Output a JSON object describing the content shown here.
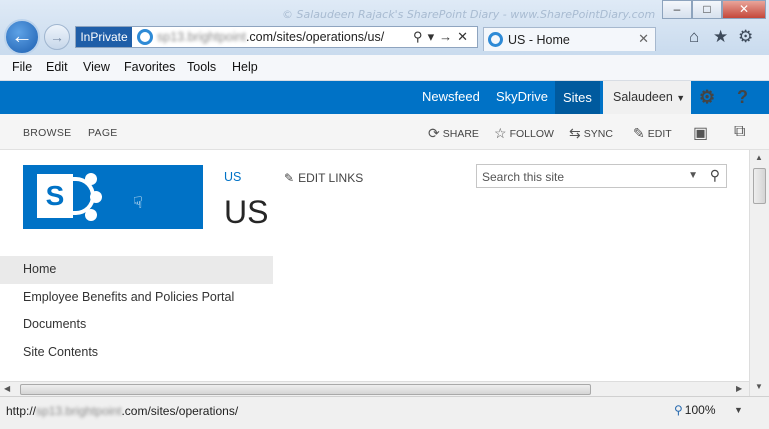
{
  "browser": {
    "watermark": "© Salaudeen Rajack's SharePoint Diary - www.SharePointDiary.com",
    "inprivate_label": "InPrivate",
    "address": {
      "scheme": "",
      "host_blurred": "sp13.brightpoint",
      "path": ".com/sites/operations/us/"
    },
    "tab_title": "US - Home",
    "window_buttons": {
      "minimize": "–",
      "maximize": "□",
      "close": "✕"
    },
    "icons": {
      "back": "back-arrow-icon",
      "forward": "forward-arrow-icon",
      "home": "home-icon",
      "favorites": "star-icon",
      "tools": "gear-icon"
    },
    "menu": [
      "File",
      "Edit",
      "View",
      "Favorites",
      "Tools",
      "Help"
    ]
  },
  "suitebar": {
    "links": [
      "Newsfeed",
      "SkyDrive",
      "Sites"
    ],
    "active": "Sites",
    "user": "Salaudeen",
    "settings_icon": "gear-icon",
    "help_icon": "?"
  },
  "ribbon": {
    "tabs": [
      "BROWSE",
      "PAGE"
    ],
    "actions": [
      {
        "label": "SHARE",
        "icon": "share-icon"
      },
      {
        "label": "FOLLOW",
        "icon": "star-icon"
      },
      {
        "label": "SYNC",
        "icon": "sync-icon"
      },
      {
        "label": "EDIT",
        "icon": "pencil-icon"
      }
    ],
    "focus_icon": "focus-icon",
    "popout_icon": "popout-icon"
  },
  "page": {
    "breadcrumb": "US",
    "title": "US",
    "edit_links": "EDIT LINKS",
    "search_placeholder": "Search this site",
    "quicklaunch": [
      "Home",
      "Employee Benefits and Policies Portal",
      "Documents",
      "Site Contents"
    ],
    "selected_nav": "Home"
  },
  "status": {
    "url_prefix": "http://",
    "url_host_blurred": "sp13.brightpoint",
    "url_path": ".com/sites/operations/",
    "zoom": "100%"
  }
}
